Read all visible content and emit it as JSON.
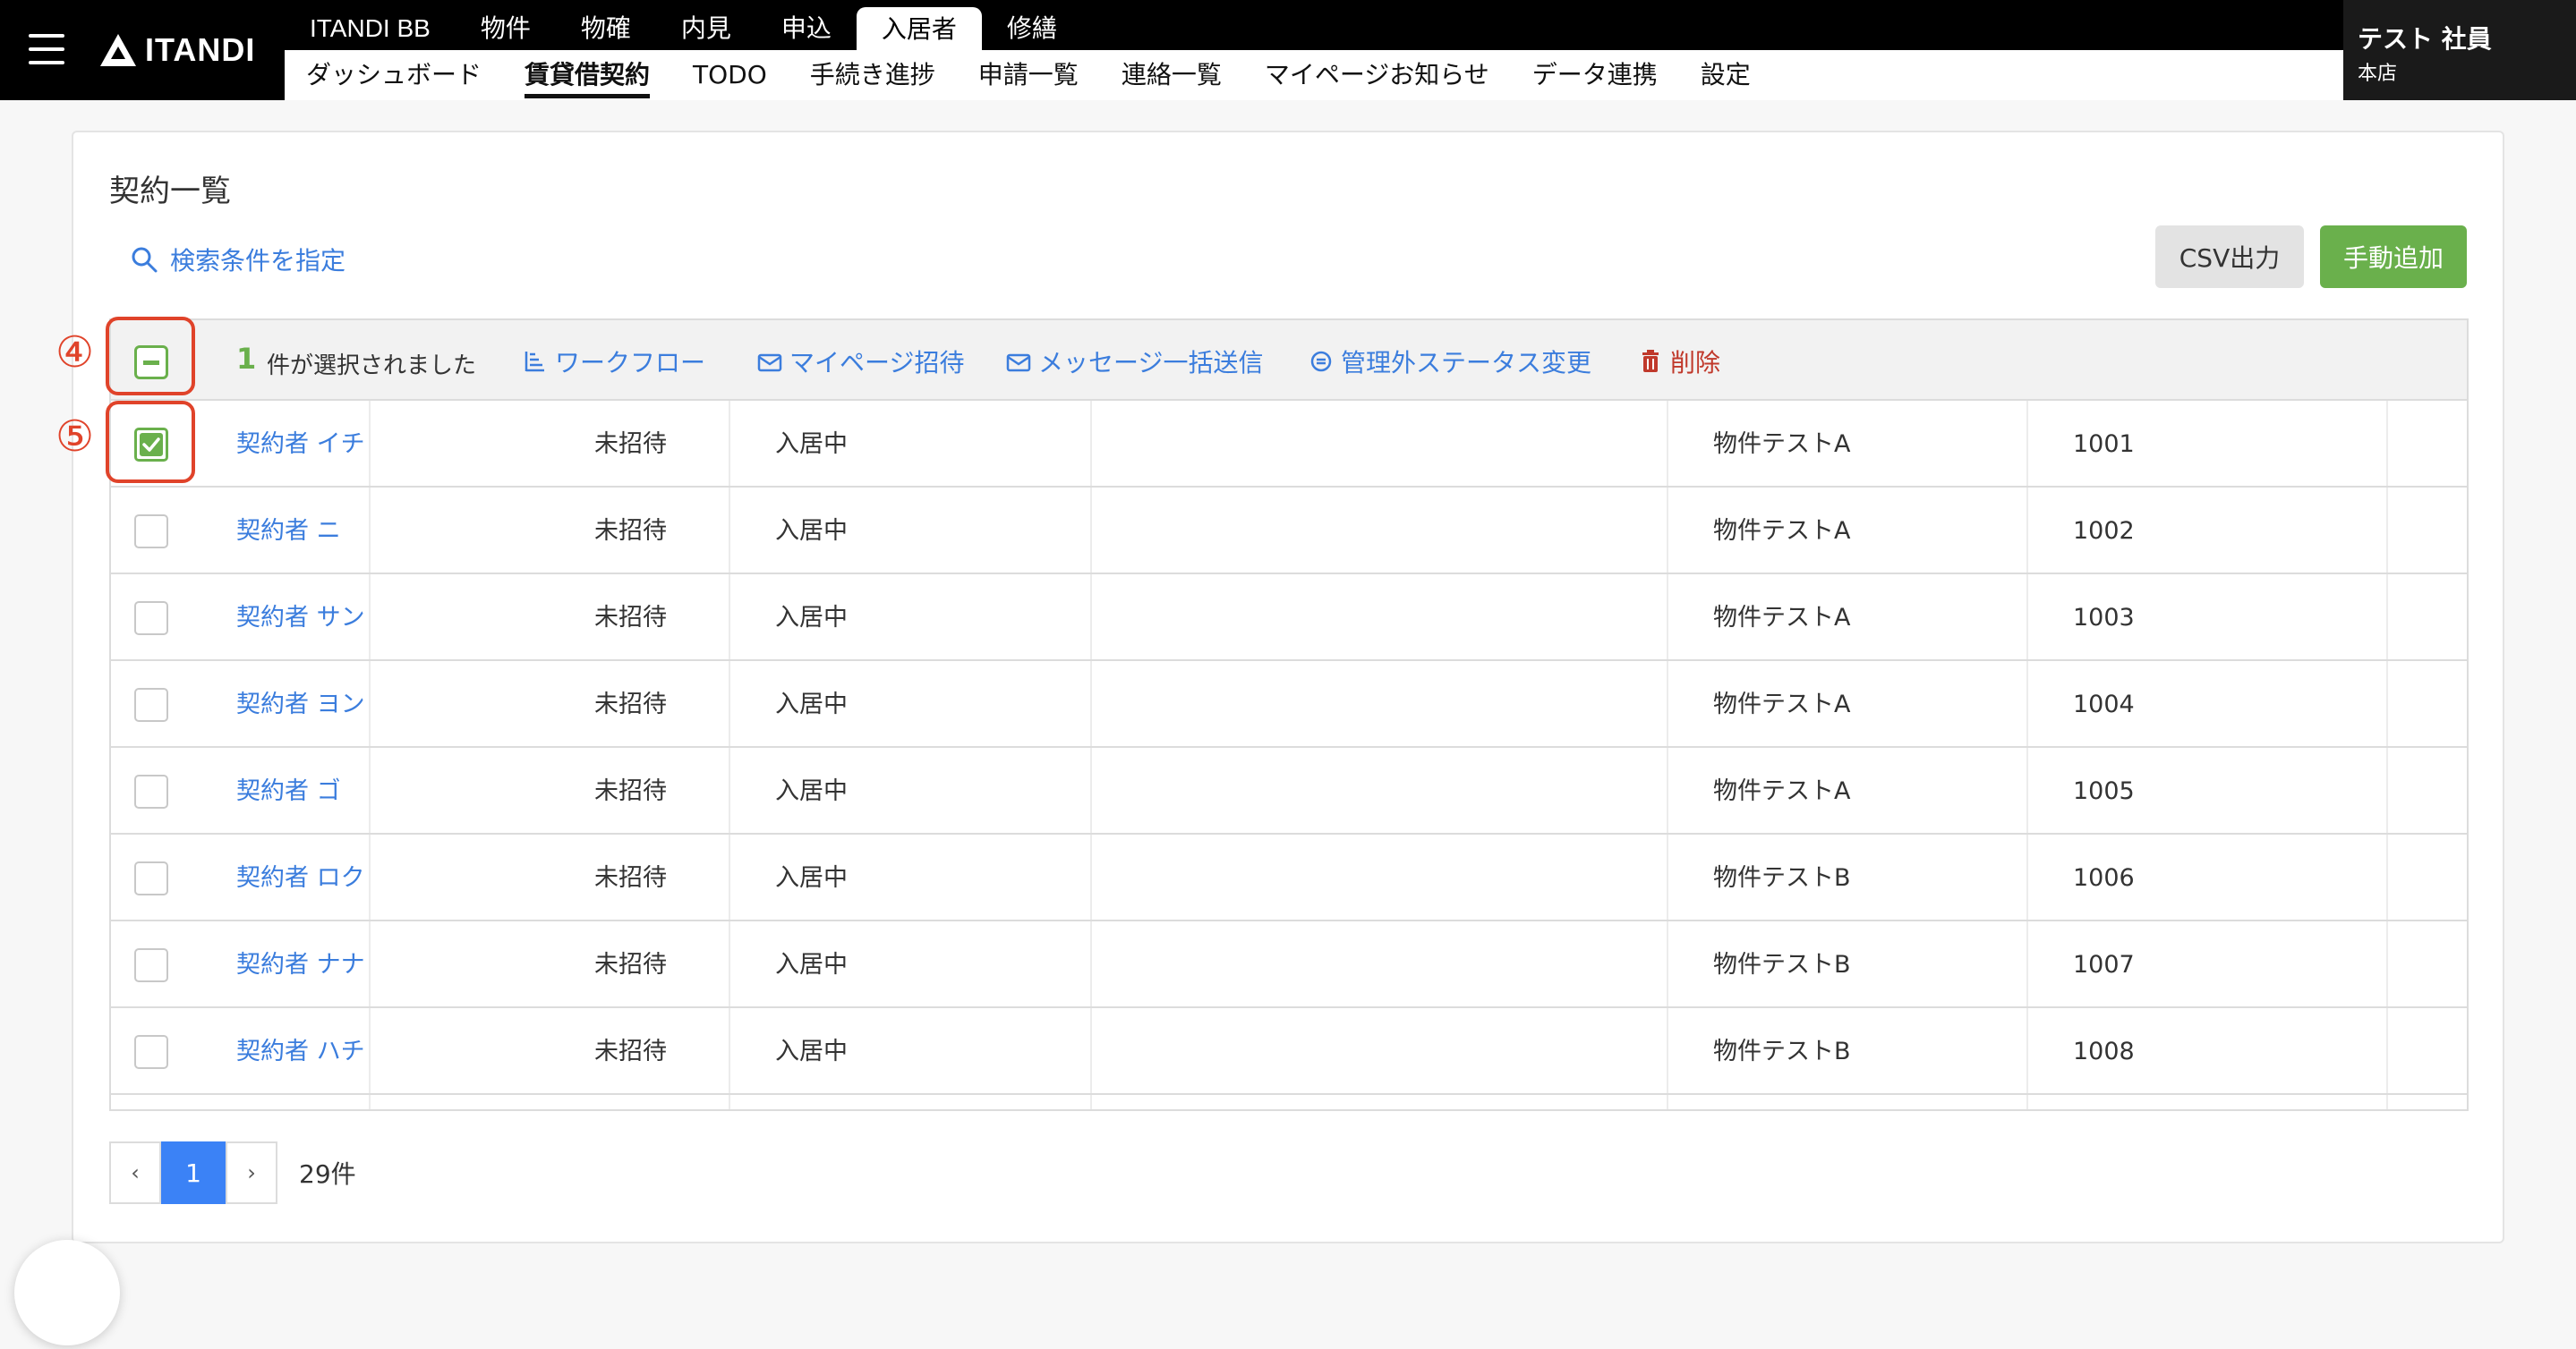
{
  "header": {
    "logo_text": "ITANDI",
    "top_tabs": [
      {
        "label": "ITANDI BB",
        "active": false
      },
      {
        "label": "物件",
        "active": false
      },
      {
        "label": "物確",
        "active": false
      },
      {
        "label": "内見",
        "active": false
      },
      {
        "label": "申込",
        "active": false
      },
      {
        "label": "入居者",
        "active": true
      },
      {
        "label": "修繕",
        "active": false
      }
    ],
    "sub_nav": [
      {
        "label": "ダッシュボード",
        "active": false
      },
      {
        "label": "賃貸借契約",
        "active": true
      },
      {
        "label": "TODO",
        "active": false
      },
      {
        "label": "手続き進捗",
        "active": false
      },
      {
        "label": "申請一覧",
        "active": false
      },
      {
        "label": "連絡一覧",
        "active": false
      },
      {
        "label": "マイページお知らせ",
        "active": false
      },
      {
        "label": "データ連携",
        "active": false
      },
      {
        "label": "設定",
        "active": false
      }
    ],
    "user": {
      "name": "テスト 社員",
      "branch": "本店"
    }
  },
  "page": {
    "title": "契約一覧",
    "search_link": "検索条件を指定",
    "csv_button": "CSV出力",
    "add_button": "手動追加"
  },
  "actionbar": {
    "selected_count": "1",
    "selected_text": "件が選択されました",
    "actions": {
      "workflow": "ワークフロー",
      "mypage_invite": "マイページ招待",
      "bulk_message": "メッセージ一括送信",
      "status_change": "管理外ステータス変更",
      "delete": "削除"
    }
  },
  "rows": [
    {
      "name": "契約者 イチ",
      "invite": "未招待",
      "status": "入居中",
      "property": "物件テストA",
      "room": "1001",
      "checked": true
    },
    {
      "name": "契約者 ニ",
      "invite": "未招待",
      "status": "入居中",
      "property": "物件テストA",
      "room": "1002",
      "checked": false
    },
    {
      "name": "契約者 サン",
      "invite": "未招待",
      "status": "入居中",
      "property": "物件テストA",
      "room": "1003",
      "checked": false
    },
    {
      "name": "契約者 ヨン",
      "invite": "未招待",
      "status": "入居中",
      "property": "物件テストA",
      "room": "1004",
      "checked": false
    },
    {
      "name": "契約者 ゴ",
      "invite": "未招待",
      "status": "入居中",
      "property": "物件テストA",
      "room": "1005",
      "checked": false
    },
    {
      "name": "契約者 ロク",
      "invite": "未招待",
      "status": "入居中",
      "property": "物件テストB",
      "room": "1006",
      "checked": false
    },
    {
      "name": "契約者 ナナ",
      "invite": "未招待",
      "status": "入居中",
      "property": "物件テストB",
      "room": "1007",
      "checked": false
    },
    {
      "name": "契約者 ハチ",
      "invite": "未招待",
      "status": "入居中",
      "property": "物件テストB",
      "room": "1008",
      "checked": false
    }
  ],
  "pagination": {
    "prev": "‹",
    "current": "1",
    "next": "›",
    "total": "29件"
  },
  "annotations": {
    "marker_4": "④",
    "marker_5": "⑤"
  },
  "colors": {
    "accent_green": "#6ab04c",
    "link_blue": "#3b7ddd",
    "annotation_red": "#e0432a",
    "danger": "#c0392b"
  }
}
